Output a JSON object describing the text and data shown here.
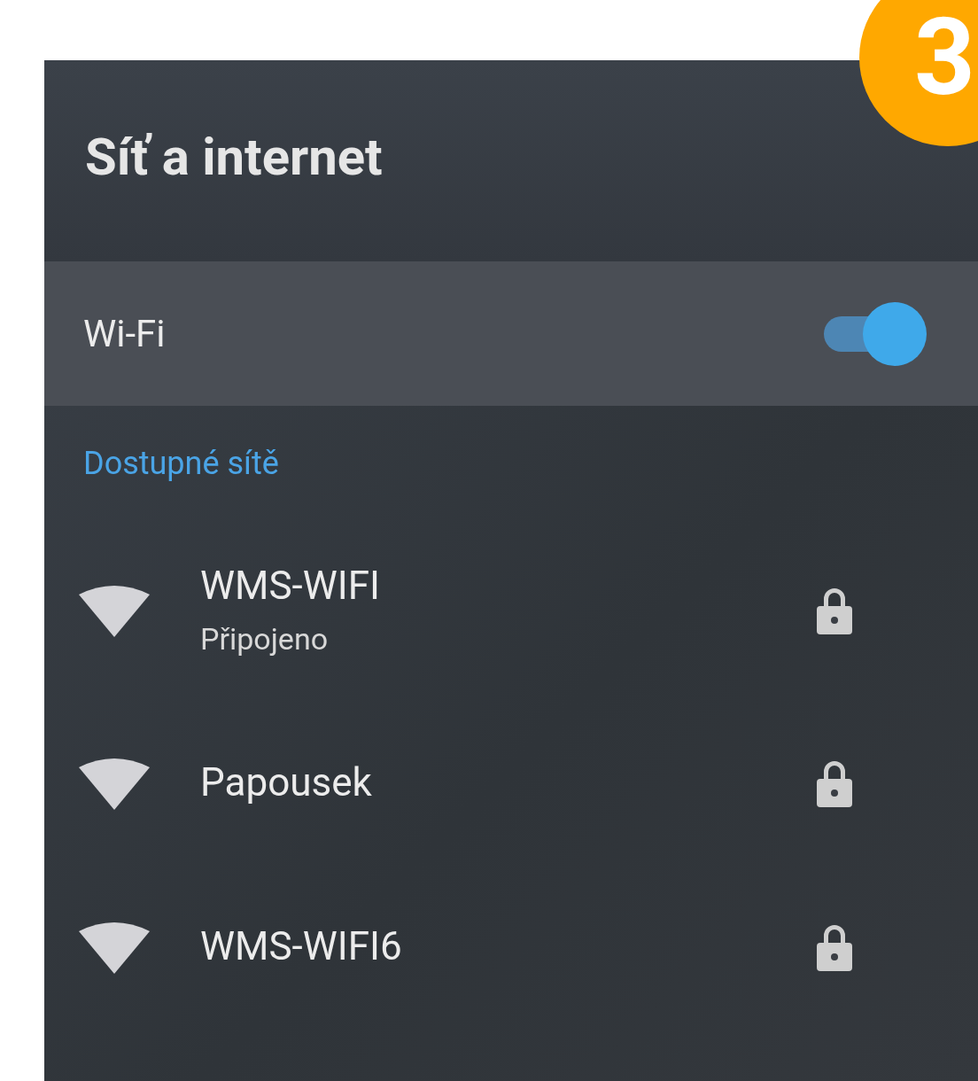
{
  "badge": "3",
  "title": "Síť a internet",
  "wifi": {
    "label": "Wi-Fi",
    "on": true
  },
  "section": "Dostupné sítě",
  "networks": [
    {
      "name": "WMS-WIFI",
      "status": "Připojeno",
      "secured": true
    },
    {
      "name": "Papousek",
      "secured": true
    },
    {
      "name": "WMS-WIFI6",
      "secured": true
    }
  ]
}
